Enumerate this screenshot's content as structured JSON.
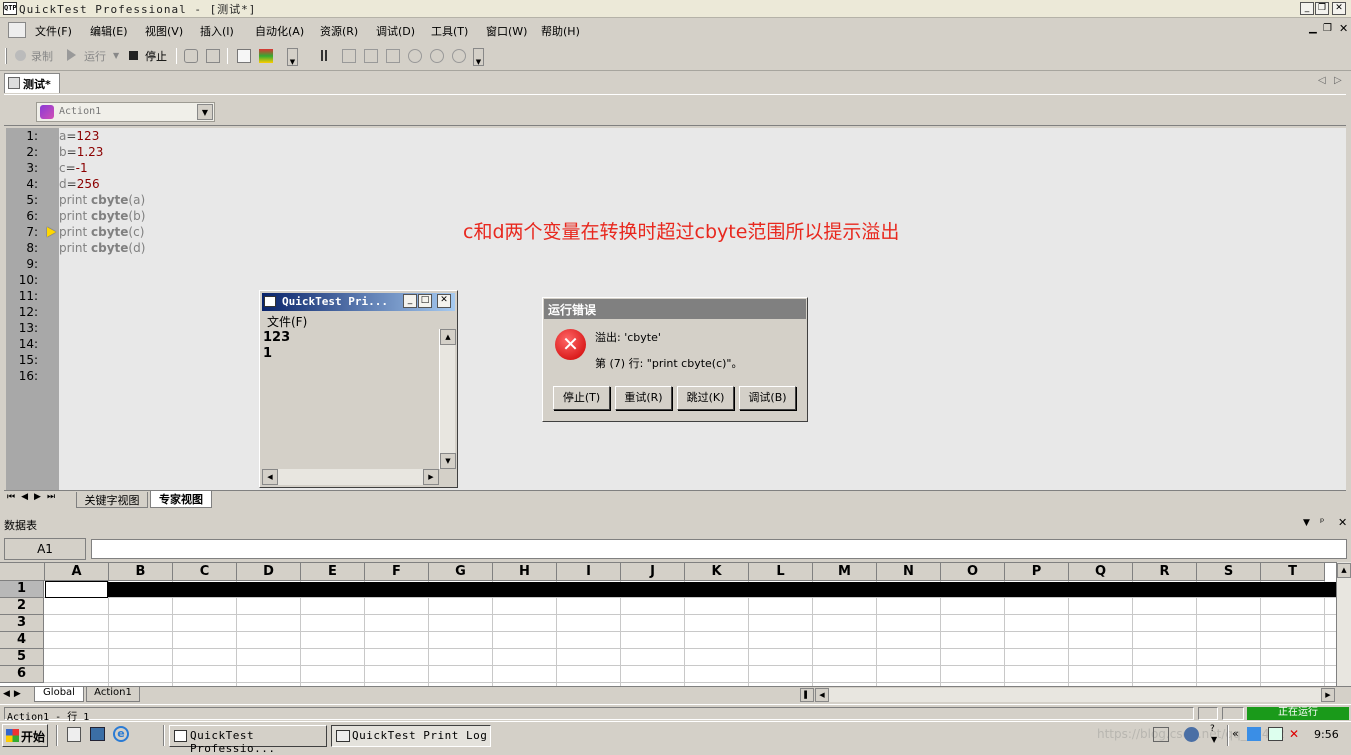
{
  "window": {
    "title": "QuickTest Professional - [测试*]",
    "icon_text": "QTP"
  },
  "menu": [
    "文件(F)",
    "编辑(E)",
    "视图(V)",
    "插入(I)",
    "自动化(A)",
    "资源(R)",
    "调试(D)",
    "工具(T)",
    "窗口(W)",
    "帮助(H)"
  ],
  "toolbar": {
    "record": "录制",
    "run": "运行",
    "stop": "停止"
  },
  "doc_tab": "测试*",
  "action_select": "Action1",
  "editor": {
    "line_numbers": [
      "1:",
      "2:",
      "3:",
      "4:",
      "5:",
      "6:",
      "7:",
      "8:",
      "9:",
      "10:",
      "11:",
      "12:",
      "13:",
      "14:",
      "15:",
      "16:"
    ],
    "lines": [
      {
        "var": "a",
        "op": "=",
        "val": "123"
      },
      {
        "var": "b",
        "op": "=",
        "val": "1.23"
      },
      {
        "var": "c",
        "op": "=",
        "val": "-1"
      },
      {
        "var": "d",
        "op": "=",
        "val": "256"
      },
      {
        "pre": "print ",
        "fn": "cbyte",
        "arg": "(a)"
      },
      {
        "pre": "print ",
        "fn": "cbyte",
        "arg": "(b)"
      },
      {
        "pre": "print ",
        "fn": "cbyte",
        "arg": "(c)"
      },
      {
        "pre": "print ",
        "fn": "cbyte",
        "arg": "(d)"
      }
    ],
    "current_line": 7,
    "annotation": "c和d两个变量在转换时超过cbyte范围所以提示溢出",
    "annotation_color": "#e8281e"
  },
  "print_log": {
    "title": "QuickTest Pri...",
    "menu": "文件(F)",
    "lines": [
      "123",
      "1"
    ]
  },
  "error_dialog": {
    "title": "运行错误",
    "message1": "溢出: 'cbyte'",
    "message2": "第 (7) 行: \"print cbyte(c)\"。",
    "buttons": [
      "停止(T)",
      "重试(R)",
      "跳过(K)",
      "调试(B)"
    ]
  },
  "view_tabs": [
    "关键字视图",
    "专家视图"
  ],
  "datatable": {
    "title": "数据表",
    "cell_ref": "A1",
    "columns": [
      "A",
      "B",
      "C",
      "D",
      "E",
      "F",
      "G",
      "H",
      "I",
      "J",
      "K",
      "L",
      "M",
      "N",
      "O",
      "P",
      "Q",
      "R",
      "S",
      "T"
    ],
    "rows": [
      "1",
      "2",
      "3",
      "4",
      "5",
      "6"
    ],
    "sheets": [
      "Global",
      "Action1"
    ]
  },
  "status": {
    "left": "Action1 - 行 1",
    "running": "正在运行",
    "running_color": "#1a9a1a"
  },
  "taskbar": {
    "start": "开始",
    "tasks": [
      "QuickTest Professio...",
      "QuickTest Print Log"
    ],
    "clock": "9:56",
    "watermark": "https://blog.csdn.net/qq_42452"
  }
}
